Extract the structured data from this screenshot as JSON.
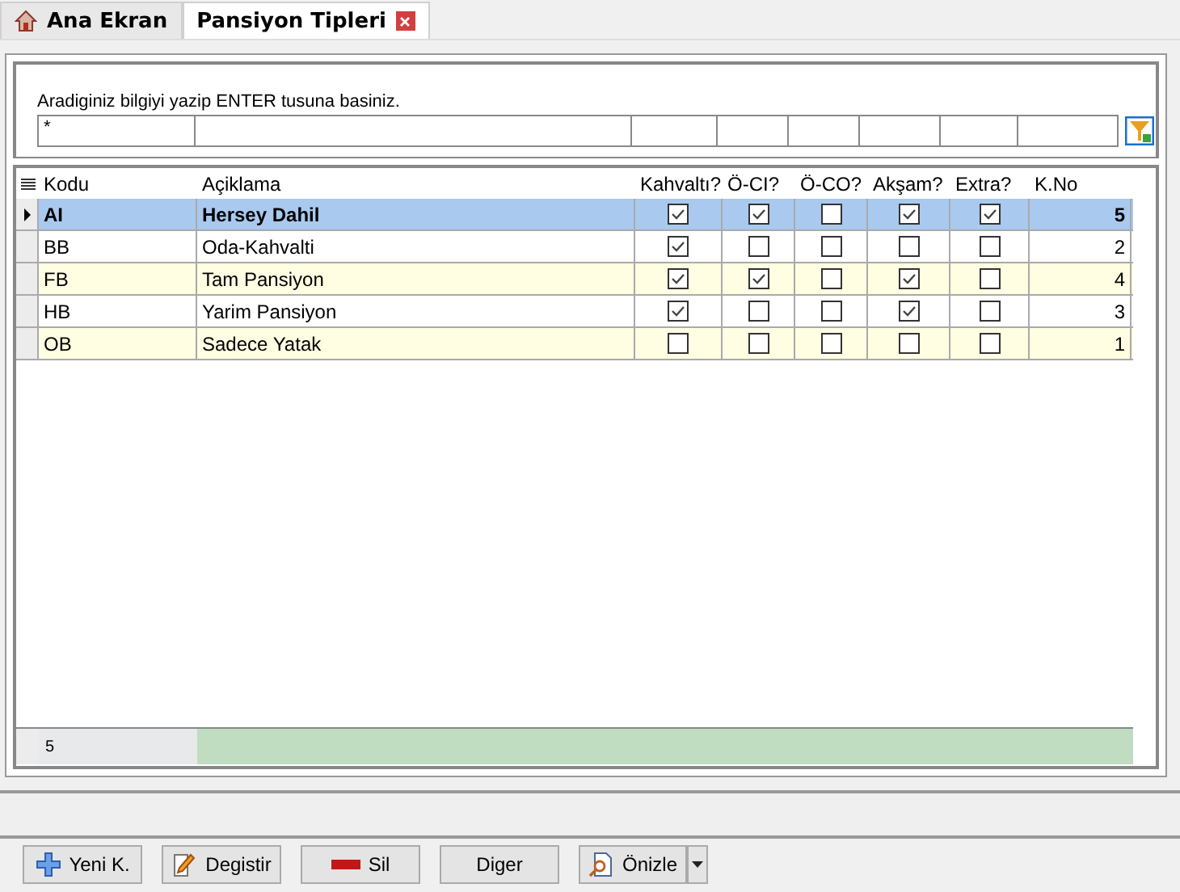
{
  "tabs": [
    {
      "label": "Ana Ekran",
      "selected": false,
      "kind": "home"
    },
    {
      "label": "Pansiyon Tipleri",
      "selected": true,
      "kind": "closable"
    }
  ],
  "search": {
    "hint": "Aradiginiz bilgiyi yazip ENTER tusuna basiniz.",
    "value": "*"
  },
  "table": {
    "columns": [
      "Kodu",
      "Açiklama",
      "Kahvaltı?",
      "Ö-CI?",
      "Ö-CO?",
      "Akşam?",
      "Extra?",
      "K.No"
    ],
    "rows": [
      {
        "code": "AI",
        "description": "Hersey Dahil",
        "checks": [
          true,
          true,
          false,
          true,
          true
        ],
        "no": "5",
        "selected": true
      },
      {
        "code": "BB",
        "description": "Oda-Kahvalti",
        "checks": [
          true,
          false,
          false,
          false,
          false
        ],
        "no": "2",
        "selected": false
      },
      {
        "code": "FB",
        "description": "Tam Pansiyon",
        "checks": [
          true,
          true,
          false,
          true,
          false
        ],
        "no": "4",
        "selected": false
      },
      {
        "code": "HB",
        "description": "Yarim Pansiyon",
        "checks": [
          true,
          false,
          false,
          true,
          false
        ],
        "no": "3",
        "selected": false
      },
      {
        "code": "OB",
        "description": "Sadece Yatak",
        "checks": [
          false,
          false,
          false,
          false,
          false
        ],
        "no": "1",
        "selected": false
      }
    ],
    "footer_count": "5"
  },
  "buttons": [
    {
      "label": "Yeni K.",
      "kind": "add"
    },
    {
      "label": "Degistir",
      "kind": "edit"
    },
    {
      "label": "Sil",
      "kind": "delete"
    },
    {
      "label": "Diger",
      "kind": "plain"
    },
    {
      "label": "Önizle",
      "kind": "preview"
    }
  ]
}
